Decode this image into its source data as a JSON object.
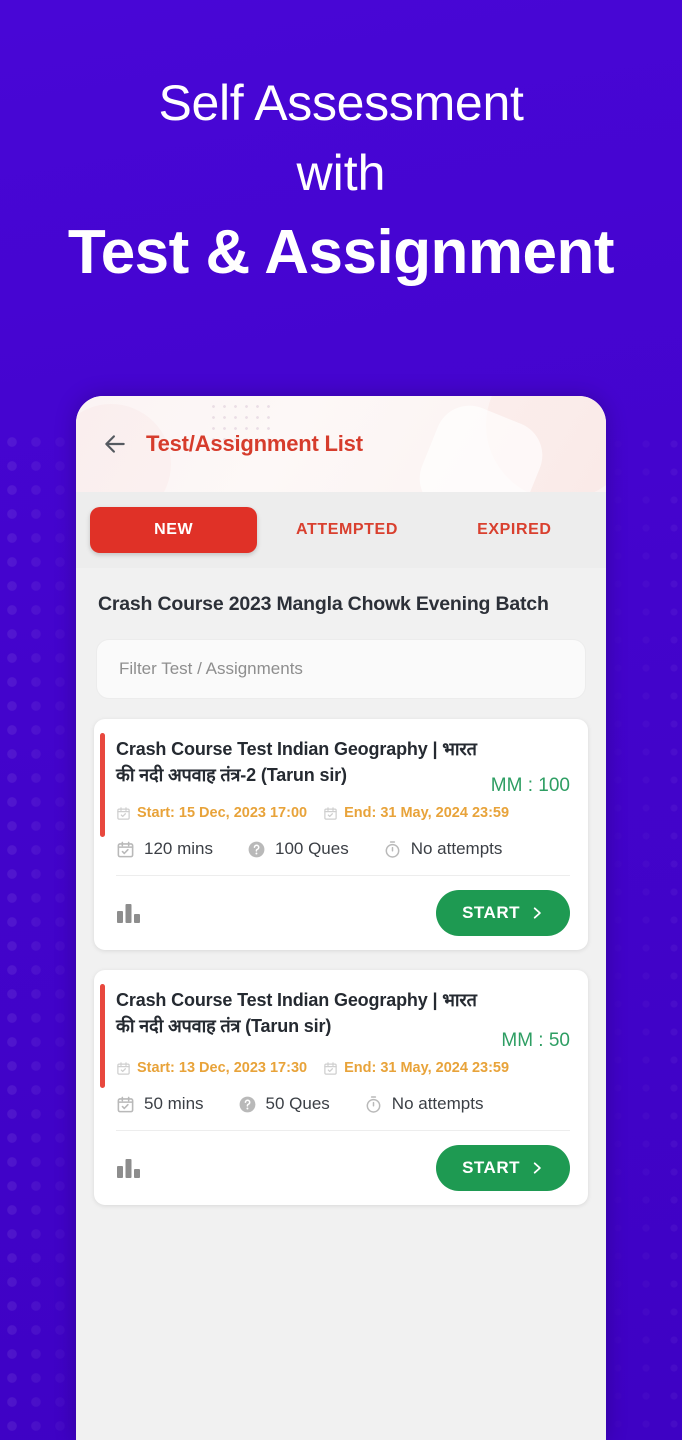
{
  "promo": {
    "line1": "Self Assessment",
    "line2": "with",
    "line3": "Test & Assignment",
    "background_color": "#4304CC"
  },
  "app": {
    "appbar": {
      "back_label": "back-arrow",
      "title": "Test/Assignment List",
      "title_color": "#D63C2C"
    },
    "tabs": [
      {
        "label": "NEW",
        "active": true
      },
      {
        "label": "ATTEMPTED",
        "active": false
      },
      {
        "label": "EXPIRED",
        "active": false
      }
    ],
    "active_tab_color": "#E03127",
    "course_title": "Crash Course 2023 Mangla Chowk Evening Batch",
    "filter": {
      "placeholder": "Filter Test / Assignments",
      "value": ""
    },
    "cards": [
      {
        "title": "Crash Course Test Indian Geography | भारत की नदी अपवाह तंत्र-2 (Tarun sir)",
        "mm_label": "MM : 100",
        "start_date": "Start: 15 Dec, 2023 17:00",
        "end_date": "End: 31 May, 2024 23:59",
        "duration": "120 mins",
        "questions": "100 Ques",
        "attempts": "No attempts",
        "action_label": "START",
        "accent_color": "#E8483E",
        "mm_color": "#2E9E63",
        "date_color": "#E8A33A",
        "button_color": "#1E9A52"
      },
      {
        "title": "Crash Course Test Indian Geography | भारत की नदी अपवाह तंत्र (Tarun sir)",
        "mm_label": "MM : 50",
        "start_date": "Start: 13 Dec, 2023 17:30",
        "end_date": "End: 31 May, 2024 23:59",
        "duration": "50 mins",
        "questions": "50 Ques",
        "attempts": "No attempts",
        "action_label": "START",
        "accent_color": "#E8483E",
        "mm_color": "#2E9E63",
        "date_color": "#E8A33A",
        "button_color": "#1E9A52"
      }
    ]
  }
}
